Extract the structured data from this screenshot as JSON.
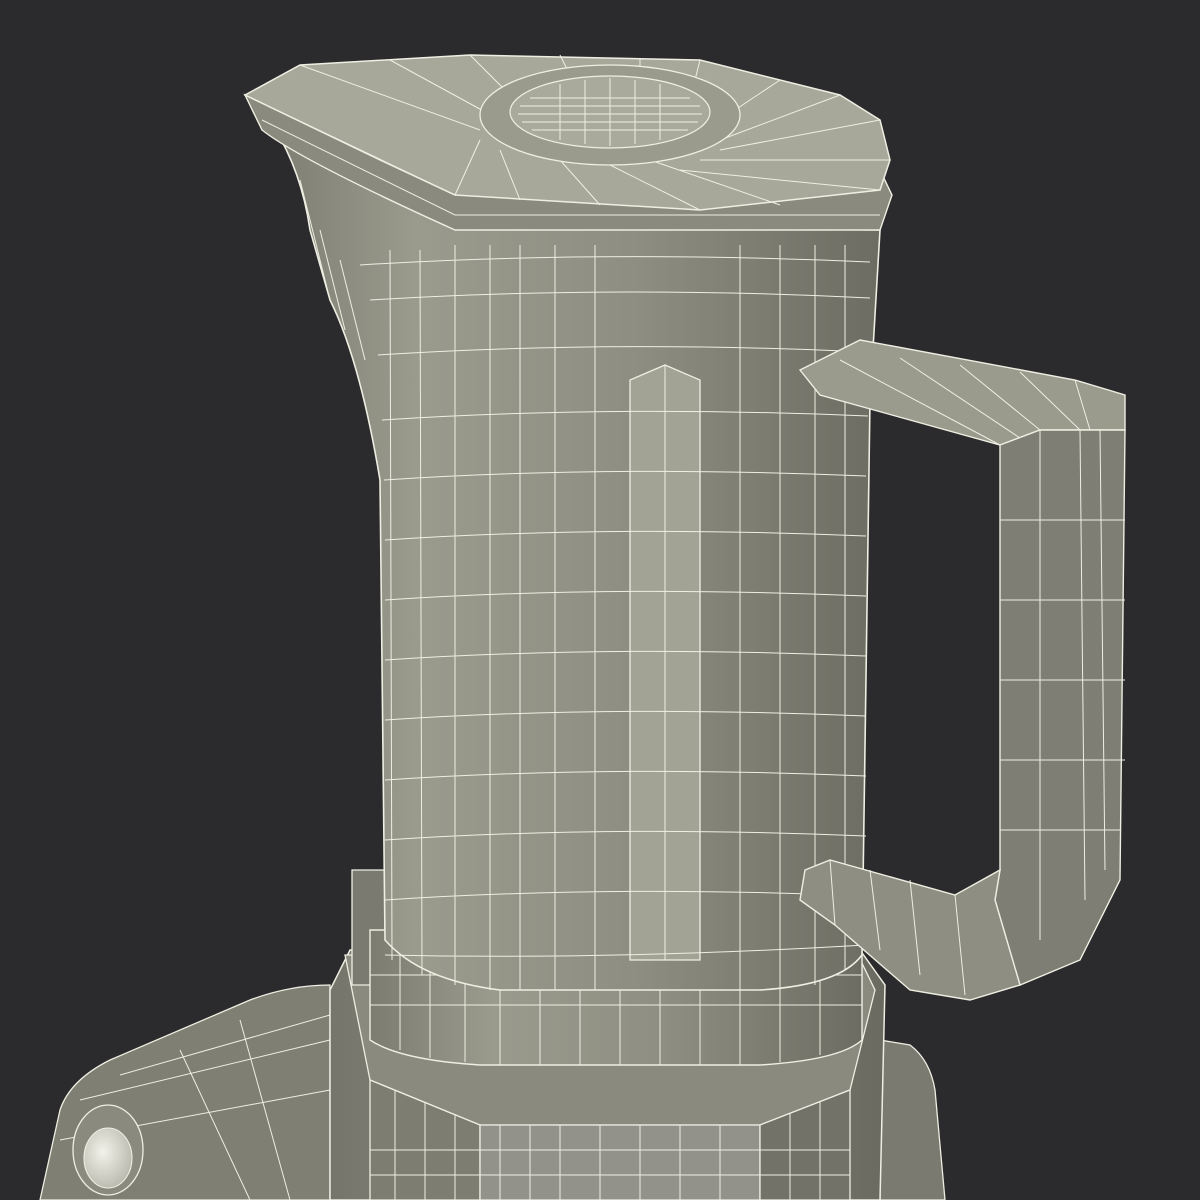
{
  "scene": {
    "subject": "blender-wireframe-render",
    "colors": {
      "background": "#2b2b2d",
      "surface": "#8c8c80",
      "surface_dark": "#6e6e64",
      "surface_light": "#a3a396",
      "wire": "#efeee2",
      "button": "#dcdcd2"
    }
  }
}
